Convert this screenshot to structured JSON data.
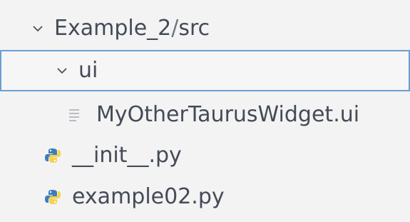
{
  "explorer": {
    "root": {
      "label": "Example_2",
      "separator": " / ",
      "subpath": "src",
      "expanded": true,
      "icon": "chevron-down-icon"
    },
    "items": [
      {
        "label": "ui",
        "type": "folder",
        "expanded": true,
        "selected": true,
        "icon": "chevron-down-icon"
      },
      {
        "label": "MyOtherTaurusWidget.ui",
        "type": "file",
        "icon": "text-file-icon"
      },
      {
        "label": "__init__.py",
        "type": "file",
        "icon": "python-file-icon"
      },
      {
        "label": "example02.py",
        "type": "file",
        "icon": "python-file-icon"
      }
    ]
  },
  "colors": {
    "background": "#f3f3f3",
    "selection_border": "#6aa0d4",
    "text": "#444b57",
    "python_blue": "#3f7db9",
    "python_yellow": "#f5d34f"
  }
}
